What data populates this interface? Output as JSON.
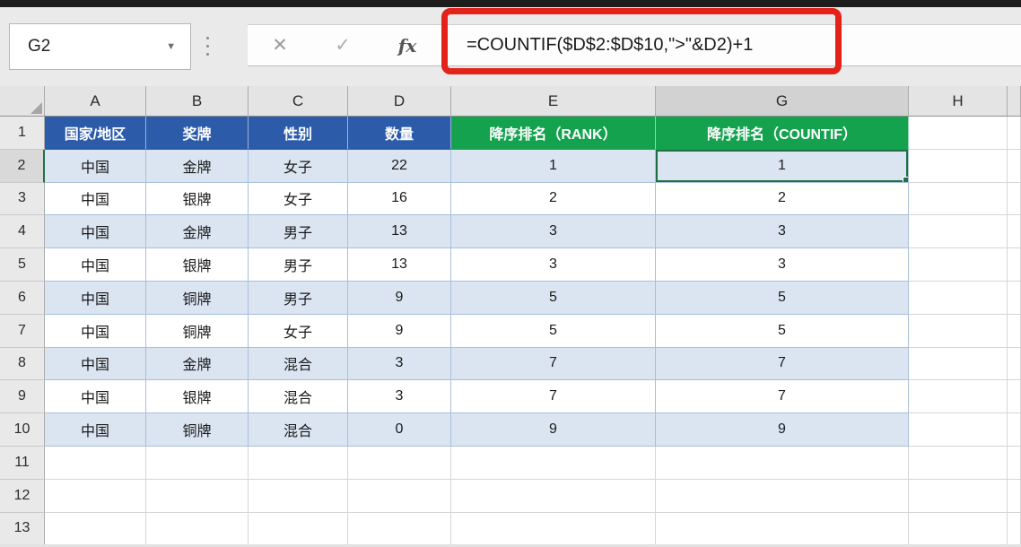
{
  "name_box": {
    "value": "G2",
    "dropdown_icon": "▼"
  },
  "formula_bar": {
    "cancel_icon": "✕",
    "enter_icon": "✓",
    "fx_icon": "fx",
    "formula": "=COUNTIF($D$2:$D$10,\">\"&D2)+1"
  },
  "colors": {
    "titlebar_dark": "#1d1d1d",
    "toolbar_bg": "#eaeaea",
    "header_blue": "#2b5ba9",
    "header_green": "#14a24e",
    "band_blue": "#dbe5f2",
    "selection_green": "#1f7145",
    "red_annotation": "#e32219"
  },
  "sheet": {
    "column_headers": [
      "A",
      "B",
      "C",
      "D",
      "E",
      "G",
      "H"
    ],
    "selected_column": "G",
    "selected_row": "2",
    "active_cell": "G2",
    "header_row": {
      "blue": [
        "国家/地区",
        "奖牌",
        "性别",
        "数量"
      ],
      "green": [
        "降序排名（RANK）",
        "降序排名（COUNTIF）"
      ]
    },
    "rows": [
      {
        "n": "2",
        "cells": [
          "中国",
          "金牌",
          "女子",
          "22",
          "1",
          "1"
        ]
      },
      {
        "n": "3",
        "cells": [
          "中国",
          "银牌",
          "女子",
          "16",
          "2",
          "2"
        ]
      },
      {
        "n": "4",
        "cells": [
          "中国",
          "金牌",
          "男子",
          "13",
          "3",
          "3"
        ]
      },
      {
        "n": "5",
        "cells": [
          "中国",
          "银牌",
          "男子",
          "13",
          "3",
          "3"
        ]
      },
      {
        "n": "6",
        "cells": [
          "中国",
          "铜牌",
          "男子",
          "9",
          "5",
          "5"
        ]
      },
      {
        "n": "7",
        "cells": [
          "中国",
          "铜牌",
          "女子",
          "9",
          "5",
          "5"
        ]
      },
      {
        "n": "8",
        "cells": [
          "中国",
          "金牌",
          "混合",
          "3",
          "7",
          "7"
        ]
      },
      {
        "n": "9",
        "cells": [
          "中国",
          "银牌",
          "混合",
          "3",
          "7",
          "7"
        ]
      },
      {
        "n": "10",
        "cells": [
          "中国",
          "铜牌",
          "混合",
          "0",
          "9",
          "9"
        ]
      }
    ],
    "empty_rows": [
      "11",
      "12",
      "13"
    ]
  }
}
